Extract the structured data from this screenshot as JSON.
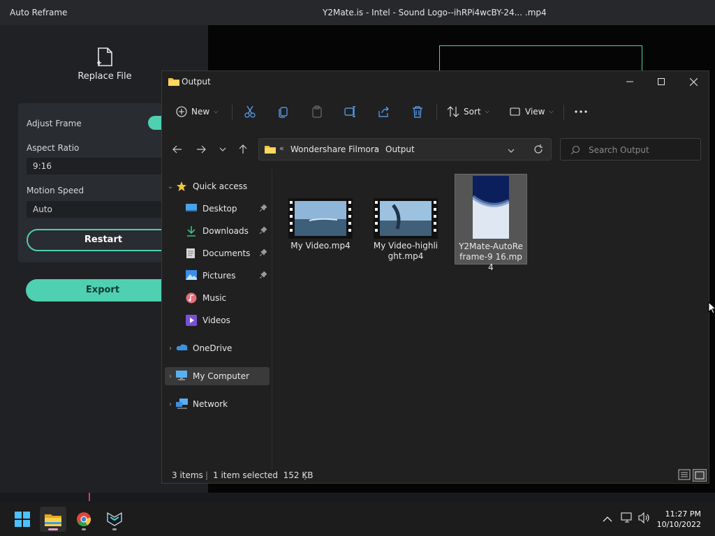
{
  "filmora": {
    "app_title": "Auto Reframe",
    "file_title": "Y2Mate.is - Intel - Sound Logo--ihRPi4wcBY-24... .mp4",
    "replace_file_label": "Replace File",
    "adjust_frame_label": "Adjust Frame",
    "aspect_ratio_label": "Aspect Ratio",
    "aspect_ratio_value": "9:16",
    "motion_speed_label": "Motion Speed",
    "motion_speed_value": "Auto",
    "restart_label": "Restart",
    "export_label": "Export",
    "adjust_frame_on": true,
    "accent_color": "#4fd1b1"
  },
  "explorer": {
    "title": "Output",
    "title_icon": "folder-icon",
    "toolbar": {
      "new_label": "New",
      "sort_label": "Sort",
      "view_label": "View",
      "actions": [
        "cut-icon",
        "copy-icon",
        "paste-icon",
        "rename-icon",
        "share-icon",
        "delete-icon",
        "more-icon"
      ]
    },
    "address": {
      "parent": "Wondershare Filmora",
      "current": "Output"
    },
    "search_placeholder": "Search Output",
    "nav": {
      "quick_access": "Quick access",
      "desktop": "Desktop",
      "downloads": "Downloads",
      "documents": "Documents",
      "pictures": "Pictures",
      "music": "Music",
      "videos": "Videos",
      "onedrive": "OneDrive",
      "my_computer": "My Computer",
      "network": "Network"
    },
    "files": [
      {
        "name": "My Video.mp4",
        "selected": false
      },
      {
        "name": "My Video-highlight.mp4",
        "selected": false
      },
      {
        "name": "Y2Mate-AutoReframe-9 16.mp4",
        "selected": true
      }
    ],
    "status": {
      "items": "3 items",
      "selected": "1 item selected  152 KB"
    }
  },
  "taskbar": {
    "apps": [
      "windows-start-icon",
      "file-explorer-icon",
      "chrome-icon",
      "filmora-icon"
    ],
    "time": "11:27 PM",
    "date": "10/10/2022"
  }
}
